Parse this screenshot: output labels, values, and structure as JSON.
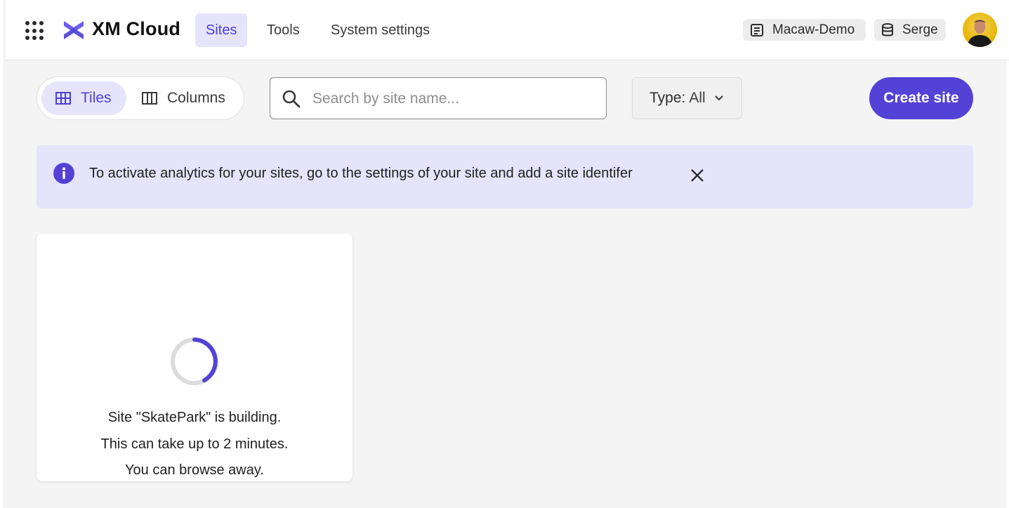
{
  "header": {
    "brand": "XM Cloud",
    "nav": [
      {
        "label": "Sites",
        "active": true
      },
      {
        "label": "Tools",
        "active": false
      },
      {
        "label": "System settings",
        "active": false
      }
    ],
    "project_chip": {
      "label": "Macaw-Demo",
      "icon": "project-icon"
    },
    "environment_chip": {
      "label": "Serge",
      "icon": "database-icon"
    },
    "avatar": {
      "icon": "user-avatar"
    }
  },
  "toolbar": {
    "view_toggle": [
      {
        "label": "Tiles",
        "icon": "grid-icon",
        "active": true
      },
      {
        "label": "Columns",
        "icon": "columns-icon",
        "active": false
      }
    ],
    "search": {
      "placeholder": "Search by site name...",
      "value": ""
    },
    "type_filter": {
      "label": "Type:",
      "value": "All"
    },
    "create_label": "Create site"
  },
  "banner": {
    "message": "To activate analytics for your sites, go to the settings of your site and add a site identifer"
  },
  "site_card": {
    "line1": "Site \"SkatePark\" is building.",
    "line2": "This can take up to 2 minutes.",
    "line3": "You can browse away."
  },
  "colors": {
    "accent": "#5442d6",
    "accent_light": "#e6e4fb",
    "background": "#f4f4f4"
  }
}
